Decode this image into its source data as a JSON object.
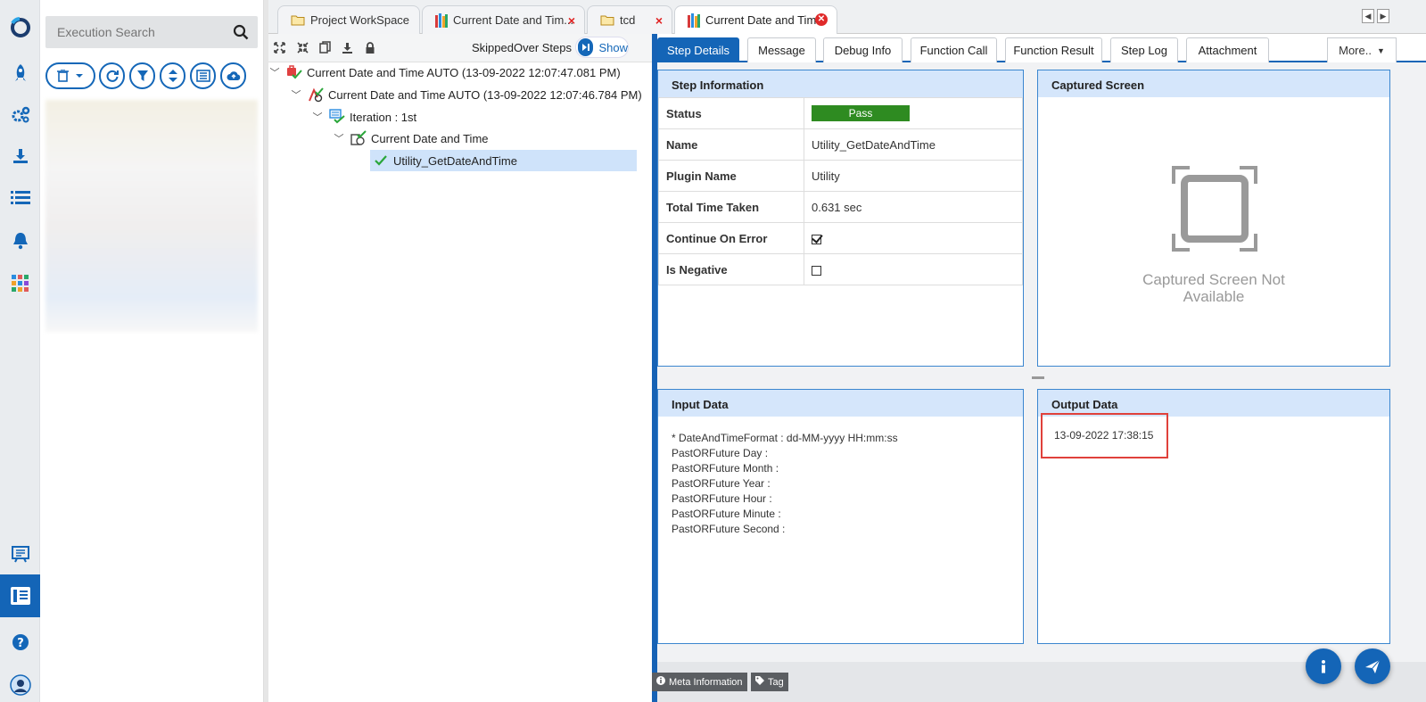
{
  "search": {
    "placeholder": "Execution Search"
  },
  "tabs": [
    {
      "label": "Project WorkSpace"
    },
    {
      "label": "Current Date and Tim..."
    },
    {
      "label": "tcd"
    },
    {
      "label": "Current Date and Tim..."
    }
  ],
  "tree_toolbar": {
    "skipped_label": "SkippedOver Steps",
    "show_label": "Show"
  },
  "tree": [
    {
      "label": "Current Date and Time AUTO (13-09-2022 12:07:47.081 PM)"
    },
    {
      "label": "Current Date and Time AUTO (13-09-2022 12:07:46.784 PM)"
    },
    {
      "label": "Iteration : 1st"
    },
    {
      "label": "Current Date and Time"
    },
    {
      "label": "Utility_GetDateAndTime"
    }
  ],
  "detail_tabs": [
    "Step Details",
    "Message",
    "Debug Info",
    "Function Call",
    "Function Result",
    "Step Log",
    "Attachment",
    "More.."
  ],
  "step_info": {
    "title": "Step Information",
    "rows": [
      {
        "key": "Status",
        "value": "Pass"
      },
      {
        "key": "Name",
        "value": "Utility_GetDateAndTime"
      },
      {
        "key": "Plugin Name",
        "value": "Utility"
      },
      {
        "key": "Total Time Taken",
        "value": "0.631 sec"
      },
      {
        "key": "Continue On Error",
        "value": ""
      },
      {
        "key": "Is Negative",
        "value": ""
      }
    ],
    "continue_on_error": true,
    "is_negative": false
  },
  "captured": {
    "title": "Captured Screen",
    "empty_text": "Captured Screen Not Available"
  },
  "input": {
    "title": "Input Data",
    "lines": [
      "* DateAndTimeFormat : dd-MM-yyyy HH:mm:ss",
      "PastORFuture Day :",
      "PastORFuture Month :",
      "PastORFuture Year :",
      "PastORFuture Hour :",
      "PastORFuture Minute :",
      "PastORFuture Second :"
    ]
  },
  "output": {
    "title": "Output Data",
    "value": "13-09-2022 17:38:15"
  },
  "bottom": {
    "meta_label": "Meta Information",
    "tag_label": "Tag"
  },
  "colors": {
    "accent": "#1465b7",
    "pass": "#2e8b21",
    "highlight": "#e0413b"
  }
}
